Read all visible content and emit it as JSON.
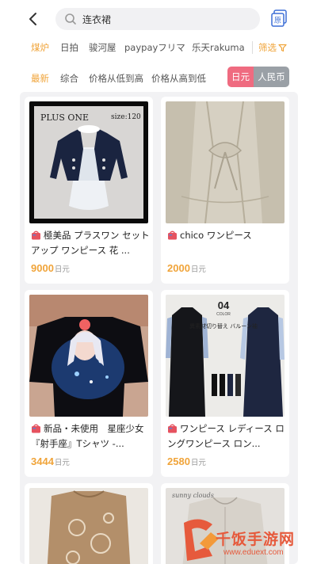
{
  "search": {
    "value": "连衣裙"
  },
  "sources": {
    "items": [
      "煤炉",
      "日拍",
      "骏河屋",
      "paypayフリマ",
      "乐天rakuma"
    ],
    "active": 0,
    "filter_label": "筛选"
  },
  "sort": {
    "items": [
      "最新",
      "综合",
      "价格从低到高",
      "价格从高到低"
    ],
    "active": 0
  },
  "currency": {
    "jpy": "日元",
    "cny": "人民币",
    "active": "jpy"
  },
  "products": [
    {
      "title": "極美品 プラスワン セットアップ ワンピース 花 ...",
      "price": "9000",
      "unit": "日元",
      "photo_label": "PLUS ONE",
      "photo_size": "size:120"
    },
    {
      "title": "chico ワンピース",
      "price": "2000",
      "unit": "日元"
    },
    {
      "title": "新品・未使用　星座少女『射手座』Tシャツ -...",
      "price": "3444",
      "unit": "日元"
    },
    {
      "title": "ワンピース レディース ロングワンピース ロン...",
      "price": "2580",
      "unit": "日元",
      "photo_badge": "04",
      "photo_badge_sub": "COLOR",
      "photo_text": "異素材切り替え バルーン袖"
    },
    {
      "photo_label": "sunny clouds"
    }
  ],
  "watermark": {
    "text": "千饭手游网",
    "url": "www.eduext.com"
  },
  "colors": {
    "accent": "#f0a43a",
    "jpy_active": "#ef6b80",
    "cny_inactive": "#9aa0a6",
    "watermark": "#e65a3c"
  }
}
